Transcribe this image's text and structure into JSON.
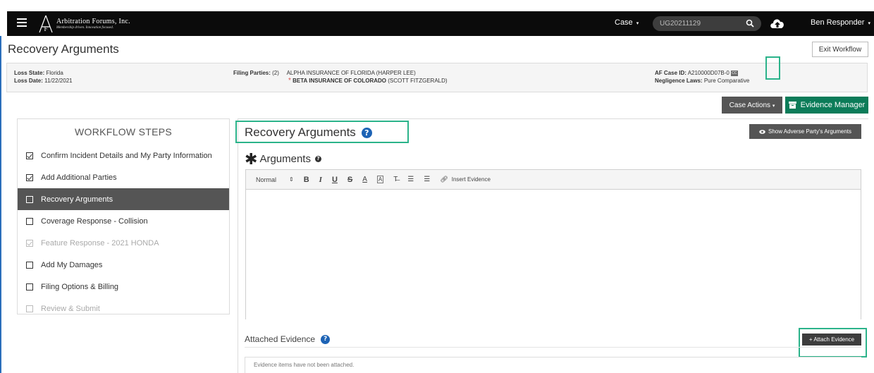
{
  "topbar": {
    "logo_name": "Arbitration Forums, Inc.",
    "logo_tagline": "Membership driven. Innovation focused.",
    "case_label": "Case",
    "search_value": "UG20211129",
    "user_name": "Ben Responder"
  },
  "page": {
    "title": "Recovery Arguments",
    "exit_label": "Exit Workflow"
  },
  "info": {
    "loss_state_label": "Loss State:",
    "loss_state": "Florida",
    "loss_date_label": "Loss Date:",
    "loss_date": "11/22/2021",
    "filing_parties_label": "Filing Parties:",
    "filing_parties_count": "(2)",
    "party_1": "ALPHA INSURANCE OF FLORIDA",
    "party_1_contact": "(HARPER LEE)",
    "party_2": "BETA INSURANCE OF COLORADO",
    "party_2_contact": "(SCOTT FITZGERALD)",
    "case_id_label": "AF Case ID:",
    "case_id": "A210000D07B-0",
    "negligence_label": "Negligence Laws:",
    "negligence_value": "Pure Comparative",
    "cc_badge": "CC"
  },
  "actions": {
    "case_actions": "Case Actions",
    "evidence_manager": "Evidence Manager"
  },
  "workflow": {
    "title": "WORKFLOW STEPS",
    "steps": [
      {
        "label": "Confirm Incident Details and My Party Information",
        "state": "checked"
      },
      {
        "label": "Add Additional Parties",
        "state": "checked"
      },
      {
        "label": "Recovery Arguments",
        "state": "active"
      },
      {
        "label": "Coverage Response - Collision",
        "state": "unchecked"
      },
      {
        "label": "Feature Response - 2021 HONDA",
        "state": "disabled-checked"
      },
      {
        "label": "Add My Damages",
        "state": "unchecked"
      },
      {
        "label": "Filing Options & Billing",
        "state": "unchecked"
      },
      {
        "label": "Review & Submit",
        "state": "disabled"
      }
    ]
  },
  "main": {
    "title": "Recovery Arguments",
    "show_adverse": "Show Adverse Party's Arguments",
    "arguments_label": "Arguments",
    "toolbar": {
      "style": "Normal",
      "bold": "B",
      "italic": "I",
      "underline": "U",
      "strike": "S",
      "insert_evidence": "Insert Evidence"
    },
    "attached_label": "Attached Evidence",
    "attach_button": "Attach Evidence",
    "no_evidence": "Evidence items have not been attached."
  }
}
